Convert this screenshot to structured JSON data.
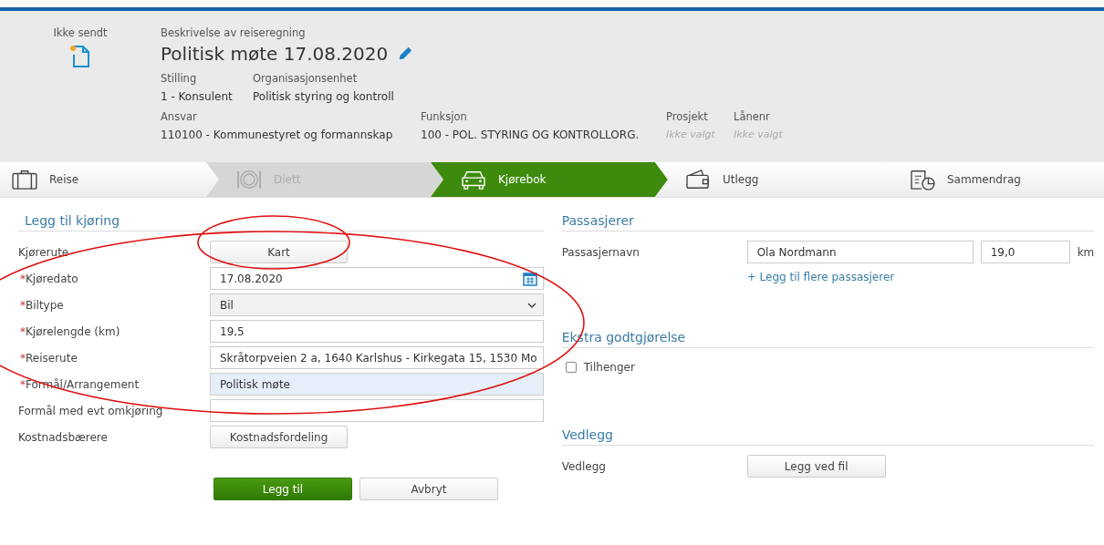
{
  "header": {
    "status": "Ikke sendt",
    "description_label": "Beskrivelse av reiseregning",
    "title": "Politisk møte 17.08.2020",
    "meta_rows": [
      [
        {
          "label": "Stilling",
          "value": "1 - Konsulent",
          "empty": false
        },
        {
          "label": "Organisasjonsenhet",
          "value": "Politisk styring og kontroll",
          "empty": false
        }
      ],
      [
        {
          "label": "Ansvar",
          "value": "110100 - Kommunestyret og formannskap",
          "empty": false
        },
        {
          "label": "Funksjon",
          "value": "100 - POL. STYRING OG KONTROLLORG.",
          "empty": false
        },
        {
          "label": "Prosjekt",
          "value": "Ikke valgt",
          "empty": true
        },
        {
          "label": "Lånenr",
          "value": "Ikke valgt",
          "empty": true
        }
      ]
    ]
  },
  "steps": [
    {
      "label": "Reise",
      "kind": "suitcase",
      "selected": false,
      "disabled": false
    },
    {
      "label": "Diett",
      "kind": "plate",
      "selected": false,
      "disabled": true
    },
    {
      "label": "Kjørebok",
      "kind": "car",
      "selected": true,
      "disabled": false
    },
    {
      "label": "Utlegg",
      "kind": "wallet",
      "selected": false,
      "disabled": false
    },
    {
      "label": "Sammendrag",
      "kind": "summary",
      "selected": false,
      "disabled": false
    }
  ],
  "form": {
    "title": "Legg til kjøring",
    "rows": [
      {
        "label": "Kjørerute",
        "kind": "button",
        "value": "Kart"
      },
      {
        "label": "Kjøredato",
        "marker": "*",
        "kind": "date",
        "value": "17.08.2020"
      },
      {
        "label": "Biltype",
        "marker": "*",
        "kind": "select",
        "value": "Bil"
      },
      {
        "label": "Kjørelengde (km)",
        "marker": "*",
        "kind": "text",
        "value": "19,5",
        "focused": false
      },
      {
        "label": "Reiserute",
        "marker": "*",
        "kind": "text",
        "value": "Skråtorpveien 2 a, 1640 Karlshus - Kirkegata 15, 1530 Mo",
        "focused": false
      },
      {
        "label": "Formål/Arrangement",
        "marker": "*",
        "kind": "text",
        "value": "Politisk møte",
        "focused": true
      },
      {
        "label": "Formål med evt omkjøring",
        "kind": "text",
        "value": "",
        "focused": false
      },
      {
        "label": "Kostnadsbærere",
        "kind": "button",
        "value": "Kostnadsfordeling"
      }
    ],
    "buttons": [
      {
        "label": "Legg til",
        "primary": true
      },
      {
        "label": "Avbryt",
        "primary": false
      }
    ]
  },
  "passengers": {
    "title": "Passasjerer",
    "label": "Passasjernavn",
    "name": "Ola Nordmann",
    "distance": "19,0",
    "unit": "km",
    "add_link": "+ Legg til flere passasjerer"
  },
  "extra": {
    "title": "Ekstra godtgjørelse",
    "options": [
      {
        "label": "Tilhenger",
        "checked": false
      }
    ]
  },
  "attachments": {
    "title": "Vedlegg",
    "label": "Vedlegg",
    "button": "Legg ved fil"
  },
  "annotations": [
    {
      "kind": "ellipse"
    },
    {
      "kind": "ellipse"
    }
  ]
}
